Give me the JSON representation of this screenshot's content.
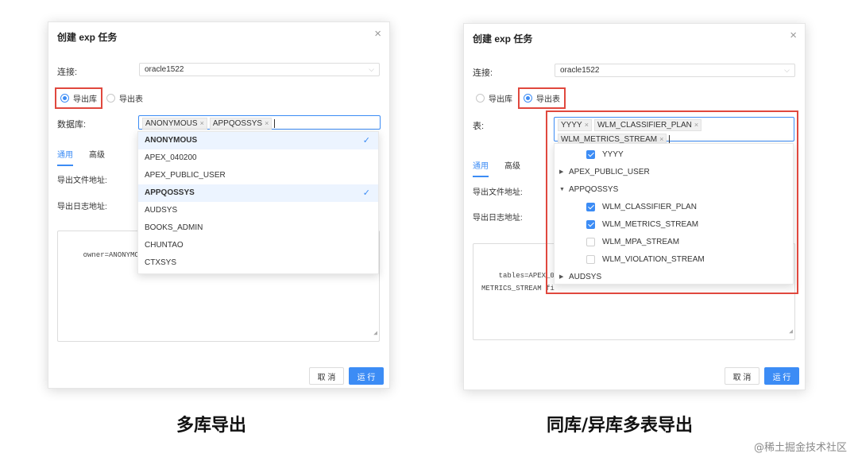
{
  "left": {
    "title": "创建 exp 任务",
    "close": "×",
    "conn_label": "连接:",
    "conn_value": "oracle1522",
    "radio_db": "导出库",
    "radio_table": "导出表",
    "db_label": "数据库:",
    "tags": [
      "ANONYMOUS",
      "APPQOSSYS"
    ],
    "tab_general": "通用",
    "tab_advanced": "高级",
    "export_file_label": "导出文件地址:",
    "export_log_label": "导出日志地址:",
    "textarea_text": "owner=ANONYMOUS,",
    "dropdown": [
      {
        "label": "ANONYMOUS",
        "selected": true
      },
      {
        "label": "APEX_040200",
        "selected": false
      },
      {
        "label": "APEX_PUBLIC_USER",
        "selected": false
      },
      {
        "label": "APPQOSSYS",
        "selected": true
      },
      {
        "label": "AUDSYS",
        "selected": false
      },
      {
        "label": "BOOKS_ADMIN",
        "selected": false
      },
      {
        "label": "CHUNTAO",
        "selected": false
      },
      {
        "label": "CTXSYS",
        "selected": false
      }
    ],
    "cancel": "取 消",
    "run": "运 行",
    "caption": "多库导出"
  },
  "right": {
    "title": "创建 exp 任务",
    "close": "×",
    "conn_label": "连接:",
    "conn_value": "oracle1522",
    "radio_db": "导出库",
    "radio_table": "导出表",
    "table_label": "表:",
    "tags": [
      "YYYY",
      "WLM_CLASSIFIER_PLAN",
      "WLM_METRICS_STREAM"
    ],
    "tab_general": "通用",
    "tab_advanced": "高级",
    "export_file_label": "导出文件地址:",
    "export_log_label": "导出日志地址:",
    "textarea_text": "tables=APEX_0402C\nMETRICS_STREAM fi",
    "tree": [
      {
        "type": "child",
        "label": "YYYY",
        "checked": true
      },
      {
        "type": "parent",
        "label": "APEX_PUBLIC_USER",
        "expanded": false
      },
      {
        "type": "parent",
        "label": "APPQOSSYS",
        "expanded": true
      },
      {
        "type": "child",
        "label": "WLM_CLASSIFIER_PLAN",
        "checked": true
      },
      {
        "type": "child",
        "label": "WLM_METRICS_STREAM",
        "checked": true
      },
      {
        "type": "child",
        "label": "WLM_MPA_STREAM",
        "checked": false
      },
      {
        "type": "child",
        "label": "WLM_VIOLATION_STREAM",
        "checked": false
      },
      {
        "type": "parent",
        "label": "AUDSYS",
        "expanded": false
      }
    ],
    "cancel": "取 消",
    "run": "运 行",
    "caption": "同库/异库多表导出"
  },
  "watermark": "@稀土掘金技术社区",
  "colors": {
    "accent": "#3c8cf5",
    "highlight_frame": "#e0483e"
  }
}
